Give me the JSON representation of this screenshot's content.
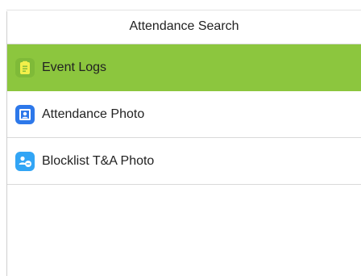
{
  "header": {
    "title": "Attendance Search"
  },
  "menu": {
    "items": [
      {
        "label": "Event Logs",
        "icon": "clipboard-icon",
        "selected": true
      },
      {
        "label": "Attendance Photo",
        "icon": "portrait-photo-icon",
        "selected": false
      },
      {
        "label": "Blocklist T&A Photo",
        "icon": "blocked-users-icon",
        "selected": false
      }
    ]
  },
  "colors": {
    "accent": "#8cc63e",
    "event_logs_icon": "#7fba38",
    "attendance_photo_icon": "#2d78ea",
    "blocklist_icon": "#32a5f5"
  }
}
